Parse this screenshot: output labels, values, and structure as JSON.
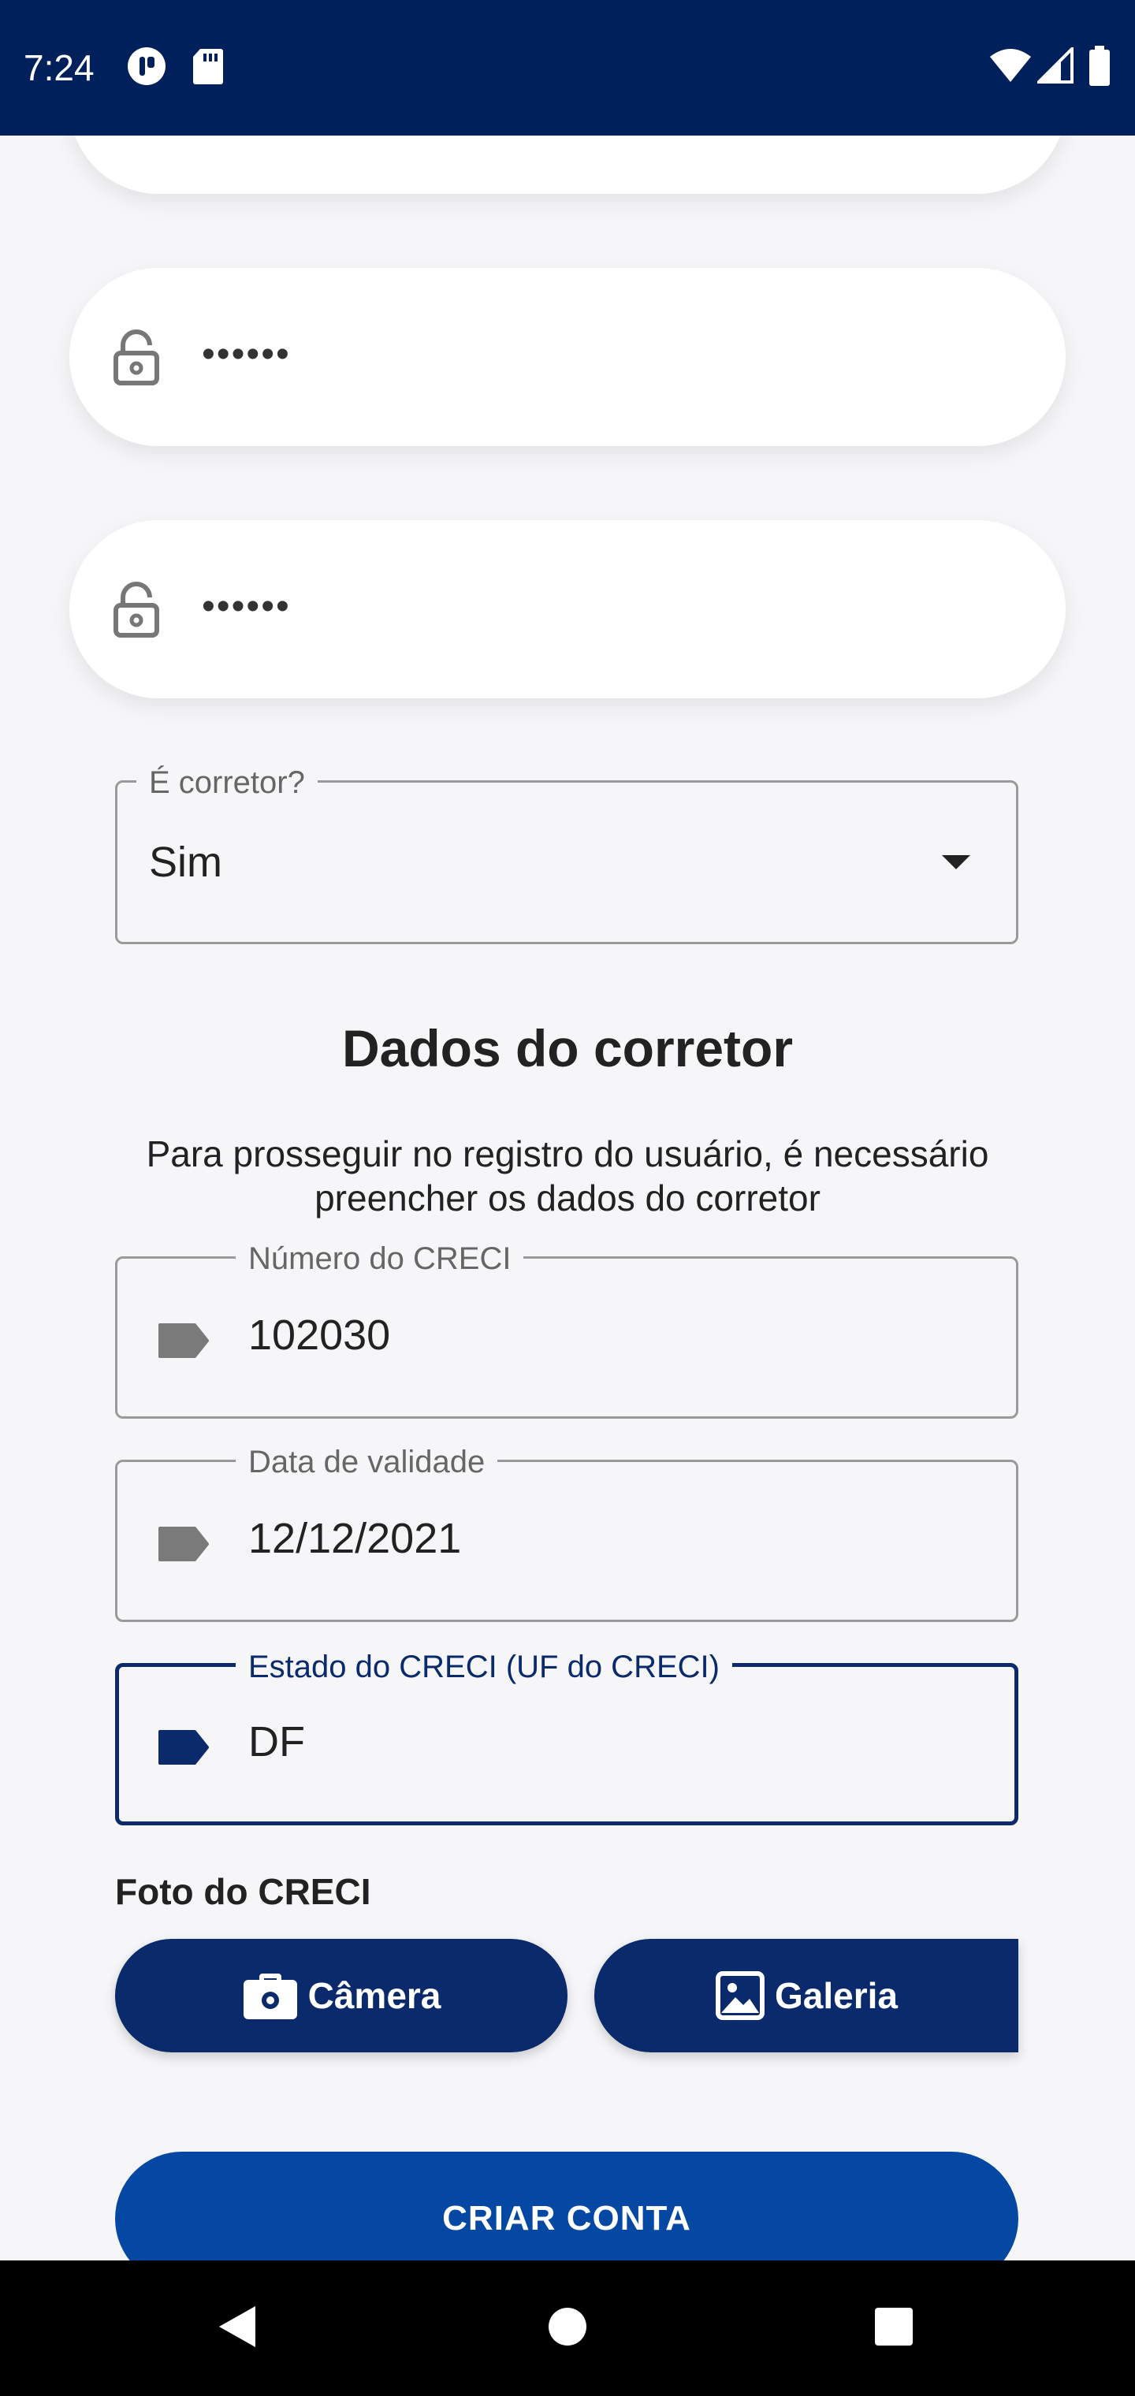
{
  "status_bar": {
    "time": "7:24"
  },
  "form": {
    "password_value": "••••••",
    "confirm_password_value": "••••••",
    "corretor_label": "É corretor?",
    "corretor_value": "Sim"
  },
  "broker_section": {
    "title": "Dados do corretor",
    "description": "Para prosseguir no registro do usuário, é necessário preencher os dados do corretor",
    "creci_number_label": "Número do CRECI",
    "creci_number_value": "102030",
    "expiry_label": "Data de validade",
    "expiry_value": "12/12/2021",
    "state_label": "Estado do CRECI (UF do CRECI)",
    "state_value": "DF",
    "photo_label": "Foto do CRECI",
    "camera_label": "Câmera",
    "gallery_label": "Galeria",
    "create_account_label": "CRIAR CONTA"
  },
  "colors": {
    "status_bar": "#00205b",
    "primary_dark": "#0a2a6b",
    "primary": "#0448a3",
    "background": "#f6f6f8"
  },
  "icons": [
    "camera-icon",
    "gallery-icon",
    "lock-icon",
    "tag-icon",
    "dropdown-arrow-icon",
    "wifi-icon",
    "signal-icon",
    "battery-icon",
    "back-icon",
    "home-icon",
    "recents-icon"
  ]
}
